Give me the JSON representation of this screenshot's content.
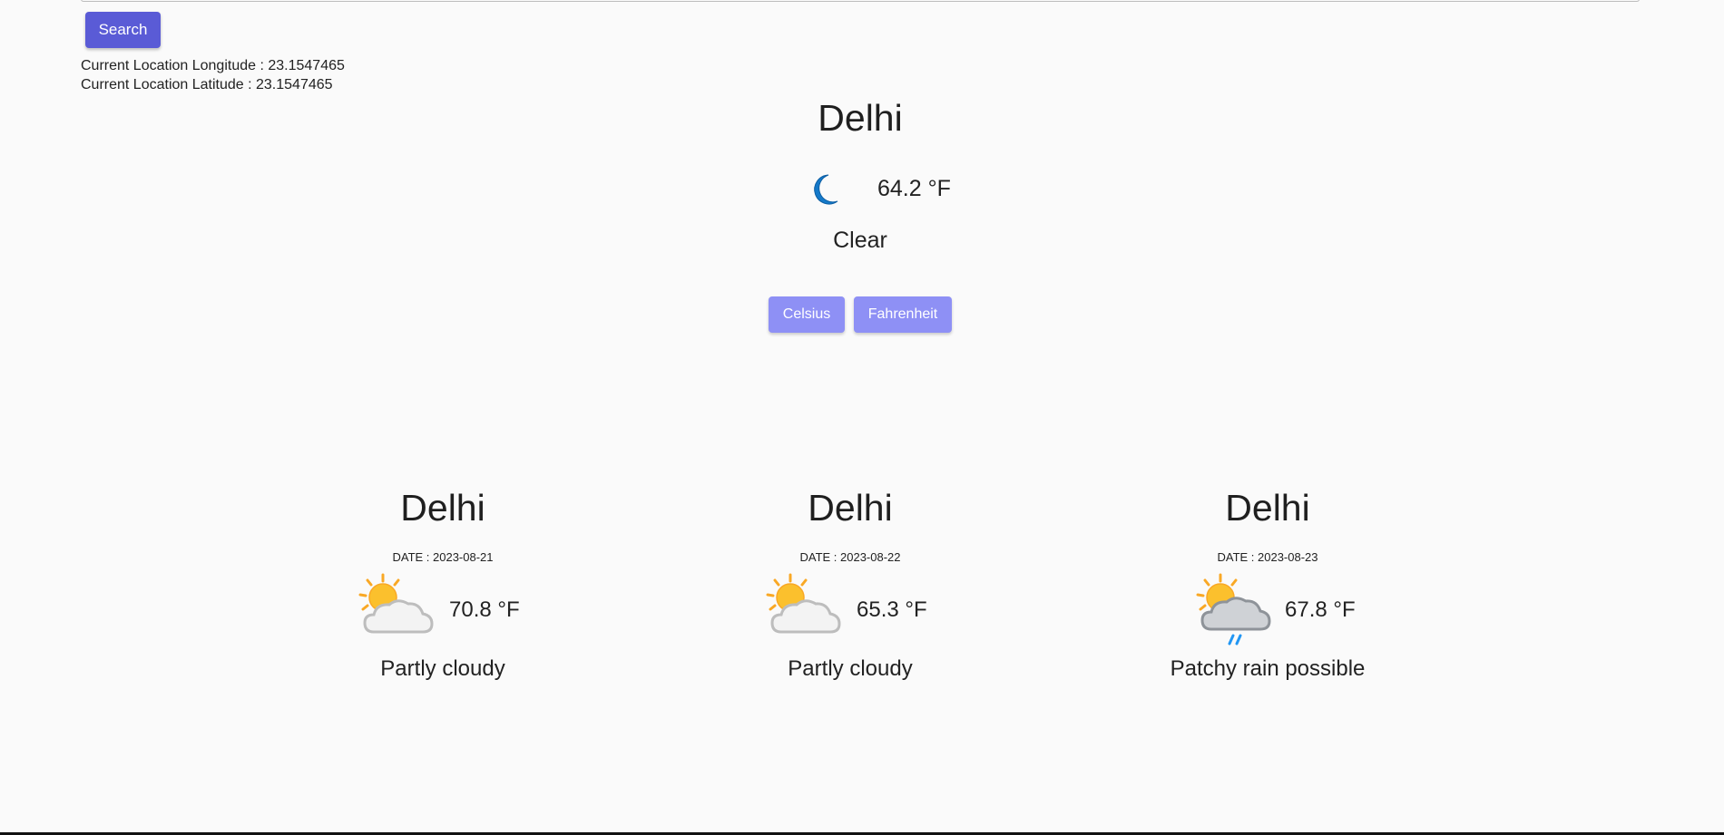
{
  "search": {
    "button_label": "Search"
  },
  "location": {
    "longitude_text": "Current Location Longitude : 23.1547465",
    "latitude_text": "Current Location Latitude : 23.1547465"
  },
  "current": {
    "city": "Delhi",
    "icon": "moon-icon",
    "temperature": "64.2 °F",
    "condition": "Clear"
  },
  "units": {
    "celsius_label": "Celsius",
    "fahrenheit_label": "Fahrenheit"
  },
  "forecast": [
    {
      "city": "Delhi",
      "date": "DATE : 2023-08-21",
      "icon": "partly-cloudy-icon",
      "temperature": "70.8 °F",
      "condition": "Partly cloudy"
    },
    {
      "city": "Delhi",
      "date": "DATE : 2023-08-22",
      "icon": "partly-cloudy-icon",
      "temperature": "65.3 °F",
      "condition": "Partly cloudy"
    },
    {
      "city": "Delhi",
      "date": "DATE : 2023-08-23",
      "icon": "patchy-rain-icon",
      "temperature": "67.8 °F",
      "condition": "Patchy rain possible"
    }
  ],
  "colors": {
    "search_button": "#5a5bd6",
    "unit_button": "#8e90f5",
    "background": "#fafafa",
    "moon": "#1479c9",
    "sun": "#fbc02d",
    "rain": "#2196f3"
  }
}
